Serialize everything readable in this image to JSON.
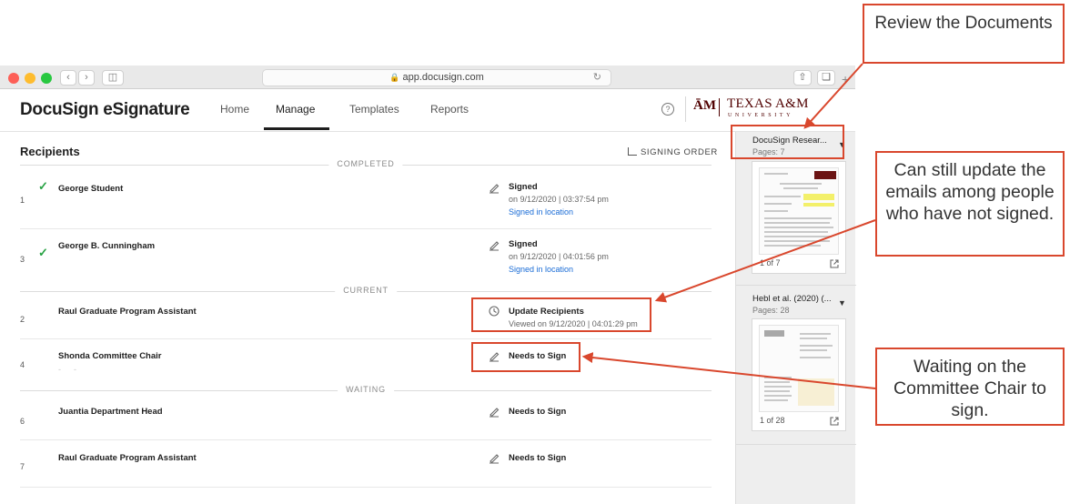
{
  "browser": {
    "url": "app.docusign.com"
  },
  "app": {
    "brand": "DocuSign eSignature",
    "tabs": [
      {
        "label": "Home"
      },
      {
        "label": "Manage"
      },
      {
        "label": "Templates"
      },
      {
        "label": "Reports"
      }
    ],
    "active_tab": "Manage",
    "org": {
      "mark": "ĀM",
      "name": "TEXAS A&M",
      "subtitle": "UNIVERSITY"
    }
  },
  "recipients": {
    "title": "Recipients",
    "signing_order_label": "SIGNING ORDER",
    "sections": [
      {
        "label": "COMPLETED"
      },
      {
        "label": "CURRENT"
      },
      {
        "label": "WAITING"
      }
    ],
    "rows": [
      {
        "order": "1",
        "name": "George Student",
        "status": "Signed",
        "date": "on 9/12/2020 | 03:37:54 pm",
        "link": "Signed in location",
        "completed": true
      },
      {
        "order": "3",
        "name": "George B. Cunningham",
        "status": "Signed",
        "date": "on 9/12/2020 | 04:01:56 pm",
        "link": "Signed in location",
        "completed": true
      },
      {
        "order": "2",
        "name": "Raul Graduate Program Assistant",
        "status": "Update Recipients",
        "date": "Viewed on 9/12/2020 | 04:01:29 pm",
        "completed": false
      },
      {
        "order": "4",
        "name": "Shonda Committee Chair",
        "status": "Needs to Sign",
        "completed": false
      },
      {
        "order": "6",
        "name": "Juantia Department Head",
        "status": "Needs to Sign",
        "completed": false
      },
      {
        "order": "7",
        "name": "Raul Graduate Program Assistant",
        "status": "Needs to Sign",
        "completed": false
      }
    ]
  },
  "documents": [
    {
      "name": "DocuSign Resear...",
      "pages": "Pages: 7",
      "page_indicator": "1 of 7"
    },
    {
      "name": "Hebl et al. (2020) (...",
      "pages": "Pages: 28",
      "page_indicator": "1 of 28"
    }
  ],
  "callouts": {
    "review": "Review the Documents",
    "update": "Can still update the emails among people who have not signed.",
    "waiting": "Waiting on the Committee Chair to sign."
  },
  "colors": {
    "annotation_red": "#d9472d",
    "check_green": "#27a243",
    "link_blue": "#1a6cd6",
    "tamu_maroon": "#500000"
  },
  "icons": {
    "status_signed": "pen-icon",
    "status_update": "clock-arrow-icon",
    "completed_check": "check-icon"
  }
}
